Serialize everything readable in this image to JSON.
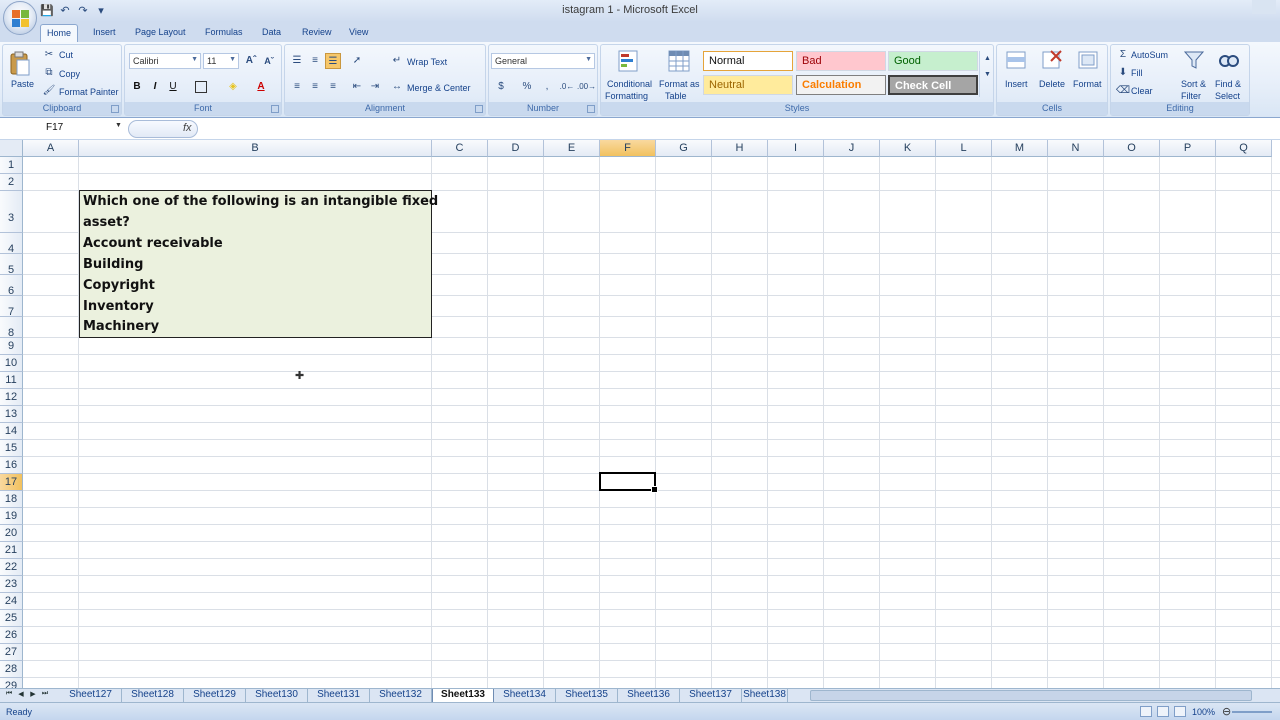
{
  "window": {
    "title": "istagram 1 - Microsoft Excel"
  },
  "tabs": [
    "Home",
    "Insert",
    "Page Layout",
    "Formulas",
    "Data",
    "Review",
    "View"
  ],
  "ribbon": {
    "clipboard": {
      "paste": "Paste",
      "cut": "Cut",
      "copy": "Copy",
      "format_painter": "Format Painter",
      "label": "Clipboard"
    },
    "font": {
      "name": "Calibri",
      "size": "11",
      "bold": "B",
      "italic": "I",
      "underline": "U",
      "font_color": "A",
      "label": "Font"
    },
    "alignment": {
      "wrap_text": "Wrap Text",
      "merge_center": "Merge & Center",
      "label": "Alignment"
    },
    "number": {
      "format": "General",
      "currency": "$",
      "percent": "%",
      "comma": ",",
      "label": "Number"
    },
    "styles": {
      "conditional_formatting_1": "Conditional",
      "conditional_formatting_2": "Formatting",
      "format_as_table_1": "Format as",
      "format_as_table_2": "Table",
      "normal": "Normal",
      "bad": "Bad",
      "good": "Good",
      "neutral": "Neutral",
      "calculation": "Calculation",
      "check_cell": "Check Cell",
      "label": "Styles"
    },
    "cells": {
      "insert": "Insert",
      "delete": "Delete",
      "format": "Format",
      "label": "Cells"
    },
    "editing": {
      "autosum": "AutoSum",
      "fill": "Fill",
      "clear": "Clear",
      "sort_1": "Sort &",
      "sort_2": "Filter",
      "find_1": "Find &",
      "find_2": "Select",
      "label": "Editing"
    }
  },
  "formula_bar": {
    "name_box": "F17",
    "fx": "fx",
    "content": ""
  },
  "columns": [
    "A",
    "B",
    "C",
    "D",
    "E",
    "F",
    "G",
    "H",
    "I",
    "J",
    "K",
    "L",
    "M",
    "N",
    "O",
    "P",
    "Q"
  ],
  "selected_column": "F",
  "rows": [
    "1",
    "2",
    "3",
    "4",
    "5",
    "6",
    "7",
    "8",
    "9",
    "10",
    "11",
    "12",
    "13",
    "14",
    "15",
    "16",
    "17",
    "18",
    "19",
    "20",
    "21",
    "22",
    "23",
    "24",
    "25",
    "26",
    "27",
    "28",
    "29"
  ],
  "selected_row": "17",
  "active_cell": "F17",
  "question_cells": {
    "line1": "Which one of the following is an intangible fixed",
    "line2": "asset?",
    "opt1": "Account receivable",
    "opt2": "Building",
    "opt3": "Copyright",
    "opt4": "Inventory",
    "opt5": "Machinery"
  },
  "sheets": [
    "Sheet127",
    "Sheet128",
    "Sheet129",
    "Sheet130",
    "Sheet131",
    "Sheet132",
    "Sheet133",
    "Sheet134",
    "Sheet135",
    "Sheet136",
    "Sheet137",
    "Sheet138"
  ],
  "active_sheet": "Sheet133",
  "status": {
    "text": "Ready",
    "zoom": "100%"
  },
  "colors": {
    "accent": "#15428b",
    "cell_fill": "#ebf1de",
    "selected_header": "#f1c15f"
  }
}
